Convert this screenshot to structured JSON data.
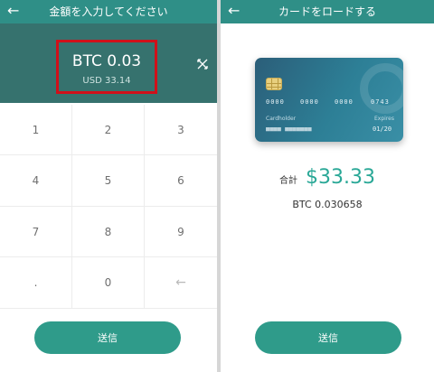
{
  "left": {
    "header": {
      "back_icon": "arrow-left-icon",
      "title": "金額を入力してください"
    },
    "amount": {
      "btc": "BTC 0.03",
      "usd": "USD 33.14",
      "swap_icon": "swap-arrows-icon"
    },
    "keypad": {
      "keys": [
        "1",
        "2",
        "3",
        "4",
        "5",
        "6",
        "7",
        "8",
        "9",
        ".",
        "0",
        ""
      ],
      "backspace_icon": "backspace-arrow-icon"
    },
    "send_label": "送信"
  },
  "right": {
    "header": {
      "back_icon": "arrow-left-icon",
      "title": "カードをロードする"
    },
    "card": {
      "number_groups": [
        "0000",
        "0000",
        "0000",
        "0743"
      ],
      "cardholder_label": "Cardholder",
      "cardholder_value": "■■■■ ■■■■■■■",
      "expires_label": "Expires",
      "expires_value": "01/20",
      "chip_icon": "chip-icon"
    },
    "total_label": "合計",
    "total_amount": "$33.33",
    "btc_amount": "BTC 0.030658",
    "send_label": "送信"
  },
  "colors": {
    "header": "#2f8f87",
    "amount_panel": "#36726e",
    "accent": "#2aa897",
    "button": "#2f9b8a",
    "highlight_border": "#d0101a"
  }
}
